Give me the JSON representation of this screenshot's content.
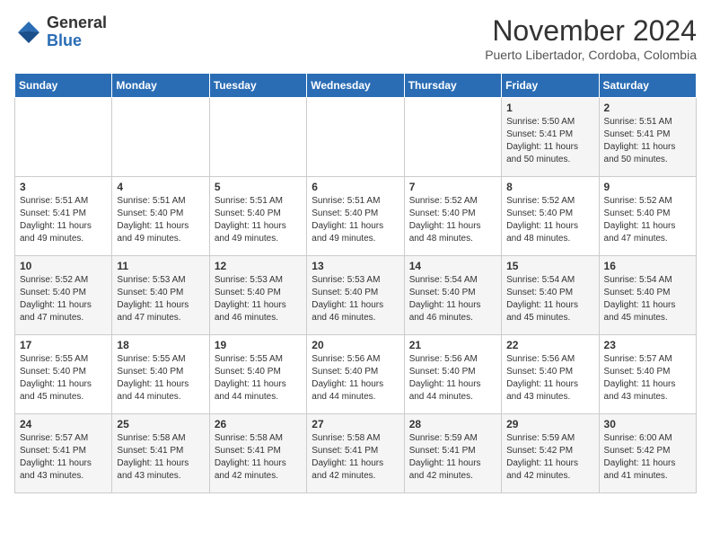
{
  "logo": {
    "general": "General",
    "blue": "Blue"
  },
  "header": {
    "month": "November 2024",
    "location": "Puerto Libertador, Cordoba, Colombia"
  },
  "days_of_week": [
    "Sunday",
    "Monday",
    "Tuesday",
    "Wednesday",
    "Thursday",
    "Friday",
    "Saturday"
  ],
  "weeks": [
    [
      {
        "day": "",
        "text": ""
      },
      {
        "day": "",
        "text": ""
      },
      {
        "day": "",
        "text": ""
      },
      {
        "day": "",
        "text": ""
      },
      {
        "day": "",
        "text": ""
      },
      {
        "day": "1",
        "text": "Sunrise: 5:50 AM\nSunset: 5:41 PM\nDaylight: 11 hours and 50 minutes."
      },
      {
        "day": "2",
        "text": "Sunrise: 5:51 AM\nSunset: 5:41 PM\nDaylight: 11 hours and 50 minutes."
      }
    ],
    [
      {
        "day": "3",
        "text": "Sunrise: 5:51 AM\nSunset: 5:41 PM\nDaylight: 11 hours and 49 minutes."
      },
      {
        "day": "4",
        "text": "Sunrise: 5:51 AM\nSunset: 5:40 PM\nDaylight: 11 hours and 49 minutes."
      },
      {
        "day": "5",
        "text": "Sunrise: 5:51 AM\nSunset: 5:40 PM\nDaylight: 11 hours and 49 minutes."
      },
      {
        "day": "6",
        "text": "Sunrise: 5:51 AM\nSunset: 5:40 PM\nDaylight: 11 hours and 49 minutes."
      },
      {
        "day": "7",
        "text": "Sunrise: 5:52 AM\nSunset: 5:40 PM\nDaylight: 11 hours and 48 minutes."
      },
      {
        "day": "8",
        "text": "Sunrise: 5:52 AM\nSunset: 5:40 PM\nDaylight: 11 hours and 48 minutes."
      },
      {
        "day": "9",
        "text": "Sunrise: 5:52 AM\nSunset: 5:40 PM\nDaylight: 11 hours and 47 minutes."
      }
    ],
    [
      {
        "day": "10",
        "text": "Sunrise: 5:52 AM\nSunset: 5:40 PM\nDaylight: 11 hours and 47 minutes."
      },
      {
        "day": "11",
        "text": "Sunrise: 5:53 AM\nSunset: 5:40 PM\nDaylight: 11 hours and 47 minutes."
      },
      {
        "day": "12",
        "text": "Sunrise: 5:53 AM\nSunset: 5:40 PM\nDaylight: 11 hours and 46 minutes."
      },
      {
        "day": "13",
        "text": "Sunrise: 5:53 AM\nSunset: 5:40 PM\nDaylight: 11 hours and 46 minutes."
      },
      {
        "day": "14",
        "text": "Sunrise: 5:54 AM\nSunset: 5:40 PM\nDaylight: 11 hours and 46 minutes."
      },
      {
        "day": "15",
        "text": "Sunrise: 5:54 AM\nSunset: 5:40 PM\nDaylight: 11 hours and 45 minutes."
      },
      {
        "day": "16",
        "text": "Sunrise: 5:54 AM\nSunset: 5:40 PM\nDaylight: 11 hours and 45 minutes."
      }
    ],
    [
      {
        "day": "17",
        "text": "Sunrise: 5:55 AM\nSunset: 5:40 PM\nDaylight: 11 hours and 45 minutes."
      },
      {
        "day": "18",
        "text": "Sunrise: 5:55 AM\nSunset: 5:40 PM\nDaylight: 11 hours and 44 minutes."
      },
      {
        "day": "19",
        "text": "Sunrise: 5:55 AM\nSunset: 5:40 PM\nDaylight: 11 hours and 44 minutes."
      },
      {
        "day": "20",
        "text": "Sunrise: 5:56 AM\nSunset: 5:40 PM\nDaylight: 11 hours and 44 minutes."
      },
      {
        "day": "21",
        "text": "Sunrise: 5:56 AM\nSunset: 5:40 PM\nDaylight: 11 hours and 44 minutes."
      },
      {
        "day": "22",
        "text": "Sunrise: 5:56 AM\nSunset: 5:40 PM\nDaylight: 11 hours and 43 minutes."
      },
      {
        "day": "23",
        "text": "Sunrise: 5:57 AM\nSunset: 5:40 PM\nDaylight: 11 hours and 43 minutes."
      }
    ],
    [
      {
        "day": "24",
        "text": "Sunrise: 5:57 AM\nSunset: 5:41 PM\nDaylight: 11 hours and 43 minutes."
      },
      {
        "day": "25",
        "text": "Sunrise: 5:58 AM\nSunset: 5:41 PM\nDaylight: 11 hours and 43 minutes."
      },
      {
        "day": "26",
        "text": "Sunrise: 5:58 AM\nSunset: 5:41 PM\nDaylight: 11 hours and 42 minutes."
      },
      {
        "day": "27",
        "text": "Sunrise: 5:58 AM\nSunset: 5:41 PM\nDaylight: 11 hours and 42 minutes."
      },
      {
        "day": "28",
        "text": "Sunrise: 5:59 AM\nSunset: 5:41 PM\nDaylight: 11 hours and 42 minutes."
      },
      {
        "day": "29",
        "text": "Sunrise: 5:59 AM\nSunset: 5:42 PM\nDaylight: 11 hours and 42 minutes."
      },
      {
        "day": "30",
        "text": "Sunrise: 6:00 AM\nSunset: 5:42 PM\nDaylight: 11 hours and 41 minutes."
      }
    ]
  ]
}
